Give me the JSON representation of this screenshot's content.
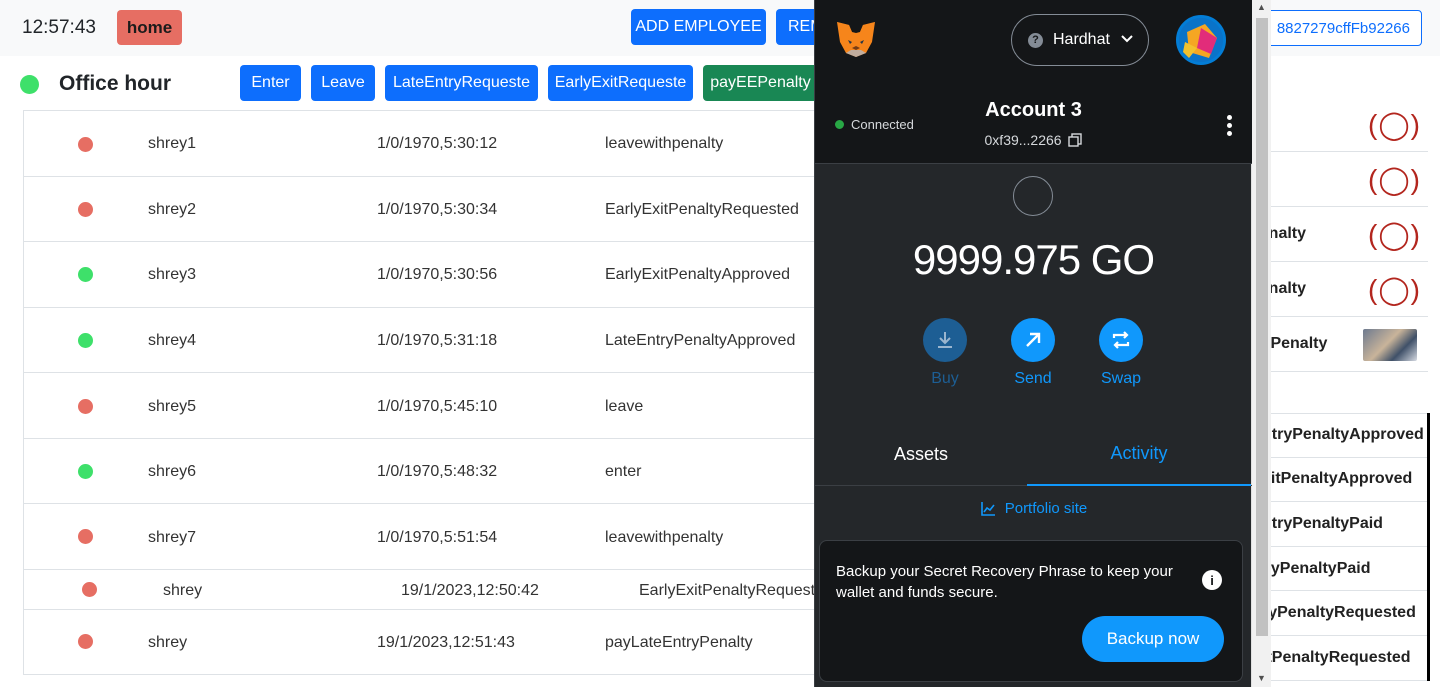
{
  "header": {
    "clock": "12:57:43",
    "home_label": "home",
    "add_employee_label": "ADD EMPLOYEE",
    "remove_label_partial": "REM",
    "address_partial": "8827279cffFb92266"
  },
  "office": {
    "title": "Office hour",
    "status_color": "#3ee06a",
    "actions": [
      "Enter",
      "Leave",
      "LateEntryRequeste",
      "EarlyExitRequeste",
      "payEEPenalty"
    ]
  },
  "table": {
    "rows": [
      {
        "status": "red",
        "name": "shrey1",
        "time": "1/0/1970,5:30:12",
        "event": "leavewithpenalty"
      },
      {
        "status": "red",
        "name": "shrey2",
        "time": "1/0/1970,5:30:34",
        "event": "EarlyExitPenaltyRequested"
      },
      {
        "status": "green",
        "name": "shrey3",
        "time": "1/0/1970,5:30:56",
        "event": "EarlyExitPenaltyApproved"
      },
      {
        "status": "green",
        "name": "shrey4",
        "time": "1/0/1970,5:31:18",
        "event": "LateEntryPenaltyApproved"
      },
      {
        "status": "red",
        "name": "shrey5",
        "time": "1/0/1970,5:45:10",
        "event": "leave"
      },
      {
        "status": "green",
        "name": "shrey6",
        "time": "1/0/1970,5:48:32",
        "event": "enter"
      },
      {
        "status": "red",
        "name": "shrey7",
        "time": "1/0/1970,5:51:54",
        "event": "leavewithpenalty"
      },
      {
        "status": "red",
        "name": "shrey",
        "time": "19/1/2023,12:50:42",
        "event": "EarlyExitPenaltyRequested"
      },
      {
        "status": "red",
        "name": "shrey",
        "time": "19/1/2023,12:51:43",
        "event": "payLateEntryPenalty"
      }
    ]
  },
  "right_table": {
    "rows": [
      {
        "text": "",
        "action": "(◯)"
      },
      {
        "text": "",
        "action": "(◯)"
      },
      {
        "text": "penalty",
        "action": "(◯)"
      },
      {
        "text": "penalty",
        "action": "(◯)"
      },
      {
        "text": "tryPenalty",
        "action": ""
      }
    ],
    "list": [
      "ntryPenaltyApproved",
      "xitPenaltyApproved",
      "ntryPenaltyPaid",
      "llyPenaltyPaid",
      "ryPenaltyRequested",
      "itPenaltyRequested"
    ]
  },
  "metamask": {
    "network": "Hardhat",
    "network_icon": "?",
    "connected_label": "Connected",
    "account_name": "Account 3",
    "account_address": "0xf39...2266",
    "balance": "9999.975 GO",
    "actions": {
      "buy": "Buy",
      "send": "Send",
      "swap": "Swap"
    },
    "tabs": {
      "assets": "Assets",
      "activity": "Activity"
    },
    "portfolio_label": "Portfolio site",
    "backup_text": "Backup your Secret Recovery Phrase to keep your wallet and funds secure.",
    "backup_button": "Backup now",
    "info_icon": "i",
    "accent_color": "#1098fc"
  }
}
